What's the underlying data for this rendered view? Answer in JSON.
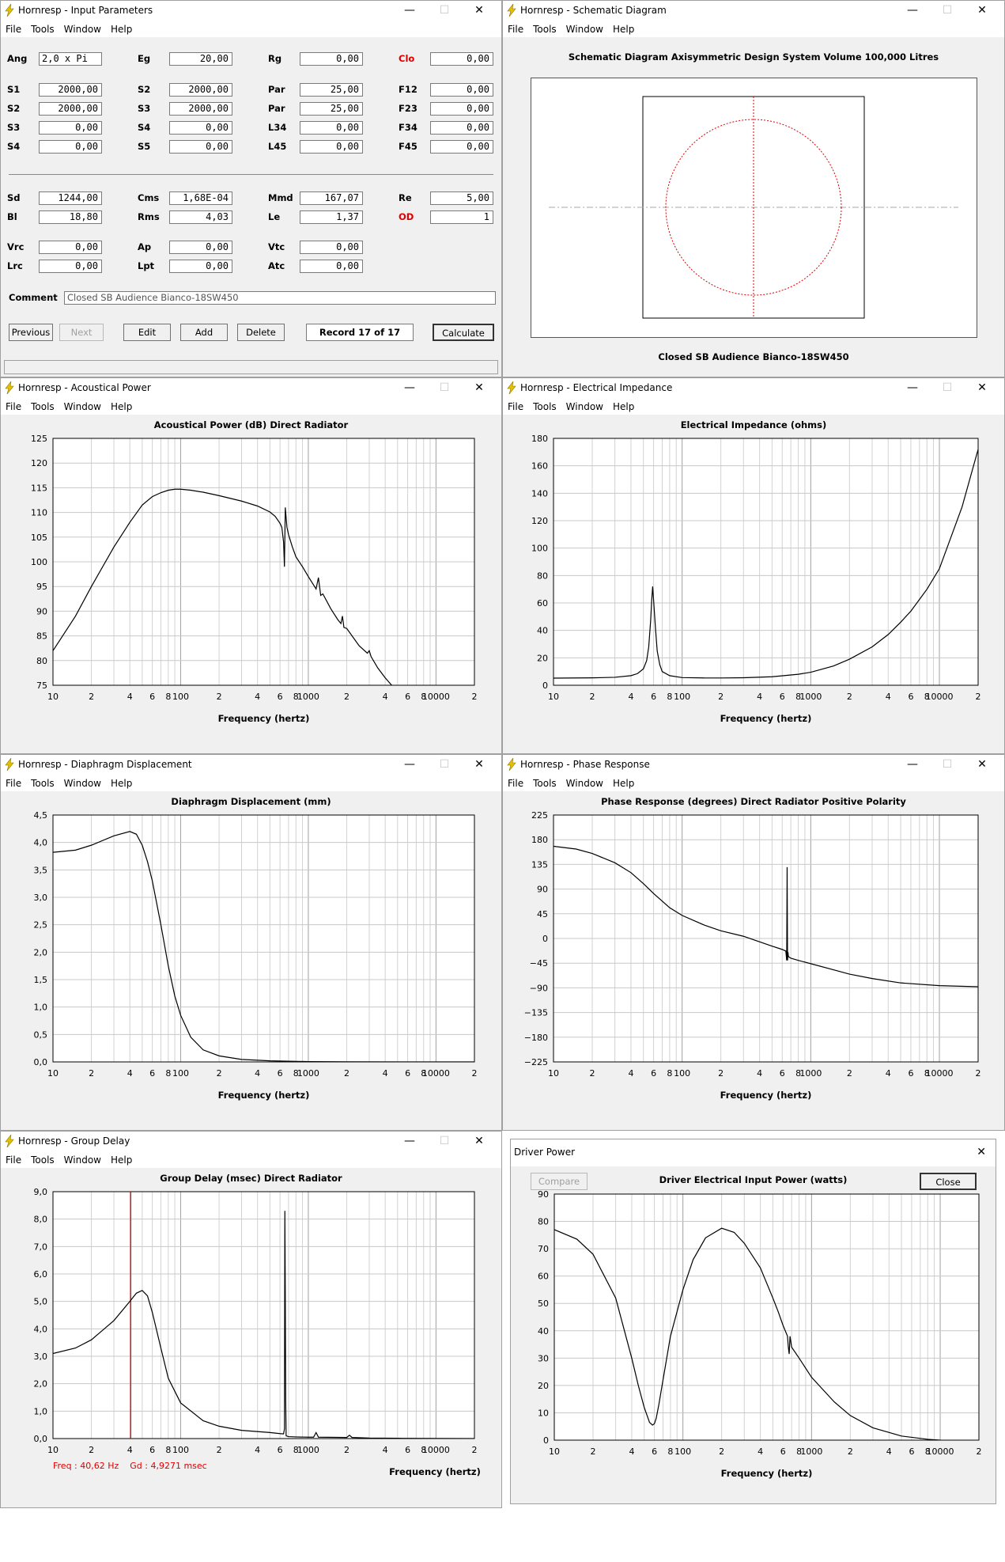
{
  "menu": [
    "File",
    "Tools",
    "Window",
    "Help"
  ],
  "ctrls": [
    "—",
    "☐",
    "✕"
  ],
  "colors": {
    "curve": "#000000",
    "cursor": "#e00000",
    "grid": "#c0c0c0",
    "circle": "#e00000"
  },
  "icons": {
    "app": "lightning-icon"
  },
  "input": {
    "title": "Hornresp - Input Parameters",
    "rows1": [
      [
        {
          "l": "Ang",
          "v": "2,0 x Pi",
          "left": true
        },
        {
          "l": "Eg",
          "v": "20,00"
        },
        {
          "l": "Rg",
          "v": "0,00"
        },
        {
          "l": "Clo",
          "v": "0,00",
          "red": true
        }
      ],
      [
        {
          "l": "S1",
          "v": "2000,00"
        },
        {
          "l": "S2",
          "v": "2000,00"
        },
        {
          "l": "Par",
          "v": "25,00"
        },
        {
          "l": "F12",
          "v": "0,00"
        }
      ],
      [
        {
          "l": "S2",
          "v": "2000,00"
        },
        {
          "l": "S3",
          "v": "2000,00"
        },
        {
          "l": "Par",
          "v": "25,00"
        },
        {
          "l": "F23",
          "v": "0,00"
        }
      ],
      [
        {
          "l": "S3",
          "v": "0,00"
        },
        {
          "l": "S4",
          "v": "0,00"
        },
        {
          "l": "L34",
          "v": "0,00"
        },
        {
          "l": "F34",
          "v": "0,00"
        }
      ],
      [
        {
          "l": "S4",
          "v": "0,00"
        },
        {
          "l": "S5",
          "v": "0,00"
        },
        {
          "l": "L45",
          "v": "0,00"
        },
        {
          "l": "F45",
          "v": "0,00"
        }
      ]
    ],
    "rows2": [
      [
        {
          "l": "Sd",
          "v": "1244,00"
        },
        {
          "l": "Cms",
          "v": "1,68E-04"
        },
        {
          "l": "Mmd",
          "v": "167,07"
        },
        {
          "l": "Re",
          "v": "5,00"
        }
      ],
      [
        {
          "l": "Bl",
          "v": "18,80"
        },
        {
          "l": "Rms",
          "v": "4,03"
        },
        {
          "l": "Le",
          "v": "1,37"
        },
        {
          "l": "OD",
          "v": "1",
          "red": true
        }
      ]
    ],
    "rows3": [
      [
        {
          "l": "Vrc",
          "v": "0,00"
        },
        {
          "l": "Ap",
          "v": "0,00"
        },
        {
          "l": "Vtc",
          "v": "0,00"
        }
      ],
      [
        {
          "l": "Lrc",
          "v": "0,00"
        },
        {
          "l": "Lpt",
          "v": "0,00"
        },
        {
          "l": "Atc",
          "v": "0,00"
        }
      ]
    ],
    "comment_label": "Comment",
    "comment": "Closed SB Audience Bianco-18SW450",
    "buttons": {
      "previous": "Previous",
      "next": "Next",
      "edit": "Edit",
      "add": "Add",
      "delete": "Delete",
      "calculate": "Calculate"
    },
    "record": "Record 17 of 17"
  },
  "schematic": {
    "title": "Hornresp - Schematic Diagram",
    "heading": "Schematic Diagram   Axisymmetric Design   System Volume 100,000 Litres",
    "caption": "Closed SB Audience Bianco-18SW450"
  },
  "acoustic": {
    "title": "Hornresp - Acoustical Power",
    "chart_data": {
      "type": "line",
      "title": "Acoustical Power (dB)   Direct Radiator",
      "xlabel": "Frequency (hertz)",
      "xscale": "log",
      "xlim": [
        10,
        20000
      ],
      "ylim": [
        75,
        125
      ],
      "y_ticks": [
        "125",
        "120",
        "115",
        "110",
        "105",
        "100",
        "95",
        "90",
        "85",
        "80",
        "75"
      ],
      "x": [
        10,
        15,
        20,
        30,
        40,
        50,
        60,
        70,
        80,
        90,
        100,
        120,
        150,
        200,
        300,
        400,
        500,
        550,
        600,
        620,
        640,
        650,
        660,
        680,
        700,
        750,
        800,
        900,
        1000,
        1150,
        1200,
        1250,
        1300,
        1500,
        1700,
        1800,
        1850,
        1900,
        2000,
        2500,
        2900,
        3000,
        3100,
        3500,
        4000,
        4500,
        5000
      ],
      "y": [
        82,
        89,
        95,
        103,
        108,
        111.5,
        113.2,
        114,
        114.5,
        114.7,
        114.7,
        114.5,
        114.1,
        113.4,
        112.3,
        111.3,
        110.1,
        109.2,
        107.8,
        107,
        104,
        99,
        111,
        107,
        105.5,
        103,
        101,
        99,
        97,
        94.5,
        96.8,
        93.2,
        93.5,
        90.5,
        88.3,
        87.5,
        89,
        86.7,
        86.5,
        83,
        81.5,
        82,
        80.8,
        78.5,
        76.5,
        75,
        74
      ]
    }
  },
  "impedance": {
    "title": "Hornresp - Electrical Impedance",
    "chart_data": {
      "type": "line",
      "title": "Electrical Impedance (ohms)",
      "xlabel": "Frequency (hertz)",
      "xscale": "log",
      "xlim": [
        10,
        20000
      ],
      "ylim": [
        0,
        180
      ],
      "y_ticks": [
        "180",
        "160",
        "140",
        "120",
        "100",
        "80",
        "60",
        "40",
        "20",
        "0"
      ],
      "x": [
        10,
        20,
        30,
        40,
        45,
        50,
        53,
        55,
        57,
        58,
        59,
        60,
        62,
        64,
        67,
        70,
        80,
        100,
        150,
        200,
        300,
        500,
        800,
        1000,
        1500,
        2000,
        3000,
        4000,
        5000,
        6000,
        8000,
        10000,
        15000,
        20000
      ],
      "y": [
        5.2,
        5.4,
        5.8,
        7,
        8.5,
        12,
        18,
        28,
        48,
        62,
        72,
        62,
        42,
        25,
        15,
        10,
        7,
        5.6,
        5.3,
        5.3,
        5.5,
        6.2,
        8,
        9.5,
        14,
        19,
        28,
        37,
        46,
        54,
        70,
        85,
        130,
        172
      ]
    }
  },
  "displacement": {
    "title": "Hornresp - Diaphragm Displacement",
    "chart_data": {
      "type": "line",
      "title": "Diaphragm Displacement (mm)",
      "xlabel": "Frequency (hertz)",
      "xscale": "log",
      "xlim": [
        10,
        20000
      ],
      "ylim": [
        0,
        4.5
      ],
      "y_ticks": [
        "4,5",
        "4,0",
        "3,5",
        "3,0",
        "2,5",
        "2,0",
        "1,5",
        "1,0",
        "0,5",
        "0,0"
      ],
      "x": [
        10,
        15,
        20,
        30,
        40,
        45,
        50,
        55,
        60,
        70,
        80,
        90,
        100,
        120,
        150,
        200,
        300,
        500,
        1000,
        2000,
        20000
      ],
      "y": [
        3.82,
        3.86,
        3.95,
        4.12,
        4.2,
        4.15,
        3.95,
        3.65,
        3.3,
        2.5,
        1.75,
        1.2,
        0.85,
        0.45,
        0.22,
        0.11,
        0.045,
        0.02,
        0.006,
        0.002,
        0
      ]
    }
  },
  "phase": {
    "title": "Hornresp - Phase Response",
    "chart_data": {
      "type": "line",
      "title": "Phase Response (degrees)   Direct Radiator   Positive Polarity",
      "xlabel": "Frequency (hertz)",
      "xscale": "log",
      "xlim": [
        10,
        20000
      ],
      "ylim": [
        -225,
        225
      ],
      "y_ticks": [
        "225",
        "180",
        "135",
        "90",
        "45",
        "0",
        "−45",
        "−90",
        "−135",
        "−180",
        "−225"
      ],
      "x": [
        10,
        15,
        20,
        30,
        40,
        50,
        60,
        70,
        80,
        100,
        150,
        200,
        300,
        500,
        600,
        640,
        650,
        655,
        660,
        665,
        670,
        700,
        800,
        1000,
        1500,
        2000,
        3000,
        5000,
        10000,
        20000
      ],
      "y": [
        168,
        163,
        155,
        138,
        120,
        100,
        82,
        68,
        56,
        42,
        24,
        14,
        4,
        -14,
        -20,
        -23,
        -40,
        130,
        -40,
        -25,
        -33,
        -36,
        -40,
        -46,
        -57,
        -65,
        -73,
        -81,
        -86,
        -88
      ]
    }
  },
  "group": {
    "title": "Hornresp - Group Delay",
    "readout": "Freq : 40,62 Hz    Gd : 4,9271 msec",
    "chart_data": {
      "type": "line",
      "title": "Group Delay (msec)   Direct Radiator",
      "xlabel": "Frequency (hertz)",
      "xscale": "log",
      "xlim": [
        10,
        20000
      ],
      "ylim": [
        0,
        9
      ],
      "cursor_x": 40.62,
      "y_ticks": [
        "9,0",
        "8,0",
        "7,0",
        "6,0",
        "5,0",
        "4,0",
        "3,0",
        "2,0",
        "1,0",
        "0,0"
      ],
      "x": [
        10,
        15,
        20,
        30,
        40,
        45,
        50,
        55,
        60,
        70,
        80,
        100,
        150,
        200,
        300,
        500,
        600,
        640,
        650,
        655,
        660,
        665,
        670,
        700,
        800,
        1000,
        1100,
        1150,
        1200,
        2000,
        2100,
        2200,
        3000,
        5000,
        20000
      ],
      "y": [
        3.1,
        3.3,
        3.6,
        4.3,
        5,
        5.3,
        5.4,
        5.2,
        4.6,
        3.3,
        2.2,
        1.3,
        0.65,
        0.45,
        0.3,
        0.22,
        0.18,
        0.17,
        0.35,
        8.3,
        5.4,
        1.4,
        0.1,
        0.07,
        0.06,
        0.05,
        0.05,
        0.22,
        0.05,
        0.04,
        0.12,
        0.04,
        0.02,
        0.01,
        0
      ]
    }
  },
  "power": {
    "title": "Driver Power",
    "compare": "Compare",
    "close": "Close",
    "chart_data": {
      "type": "line",
      "title": "Driver Electrical Input Power (watts)",
      "xlabel": "Frequency (hertz)",
      "xscale": "log",
      "xlim": [
        10,
        20000
      ],
      "ylim": [
        0,
        90
      ],
      "y_ticks": [
        "90",
        "80",
        "70",
        "60",
        "50",
        "40",
        "30",
        "20",
        "10",
        "0"
      ],
      "x": [
        10,
        15,
        20,
        30,
        40,
        45,
        50,
        55,
        58,
        60,
        62,
        65,
        70,
        80,
        100,
        120,
        150,
        200,
        250,
        300,
        400,
        500,
        550,
        600,
        650,
        660,
        670,
        680,
        700,
        800,
        1000,
        1500,
        2000,
        3000,
        5000,
        8000,
        10000
      ],
      "y": [
        77,
        73.5,
        68,
        52,
        30,
        20,
        12,
        6.5,
        5.5,
        6,
        8,
        13,
        22,
        38,
        55,
        66,
        74,
        77.5,
        76,
        72,
        63,
        52,
        47,
        42,
        38,
        34,
        31.5,
        38,
        34,
        30,
        23,
        14,
        9,
        4.5,
        1.5,
        0.3,
        0
      ]
    }
  },
  "x_tick_labels": [
    "10",
    "2",
    "4",
    "6",
    "8",
    "100",
    "2",
    "4",
    "6",
    "8",
    "1000",
    "2",
    "4",
    "6",
    "8",
    "10000",
    "2"
  ]
}
